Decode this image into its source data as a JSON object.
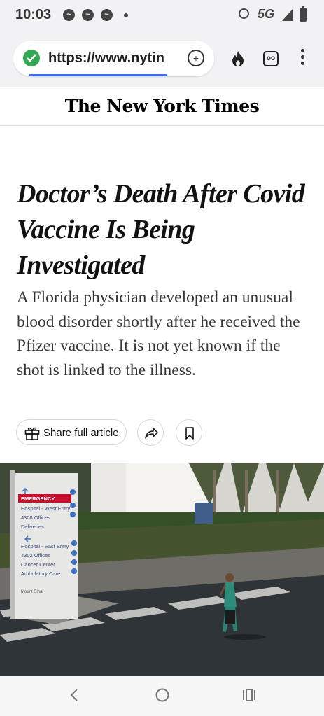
{
  "status_bar": {
    "time": "10:03",
    "network": "5G",
    "notification_icons": [
      "messenger-icon",
      "messenger-icon",
      "messenger-icon"
    ]
  },
  "browser": {
    "url": "https://www.nytin",
    "shield_color": "#35a853",
    "icons": [
      "shield-icon",
      "reader-icon",
      "flame-icon",
      "tabs-icon",
      "menu-icon"
    ]
  },
  "masthead": {
    "logo": "The New York Times"
  },
  "article": {
    "headline": "Doctor’s Death After Covid Vaccine Is Being Investigated",
    "summary": "A Florida physician developed an unusual blood disorder shortly after he received the Pfizer vaccine. It is not yet known if the shot is linked to the illness.",
    "share_label": "Share full article"
  },
  "photo": {
    "sign": {
      "line1": "EMERGENCY",
      "line2": "Hospital - West Entry",
      "line3": "4308 Offices",
      "line4": "Deliveries",
      "line5": "Hospital - East Entry",
      "line6": "4302 Offices",
      "line7": "Cancer Center",
      "line8": "Ambulatory Care",
      "line9": "Mount Sinai"
    }
  },
  "navbar": {
    "icons": [
      "back-icon",
      "home-icon",
      "recents-icon"
    ]
  }
}
